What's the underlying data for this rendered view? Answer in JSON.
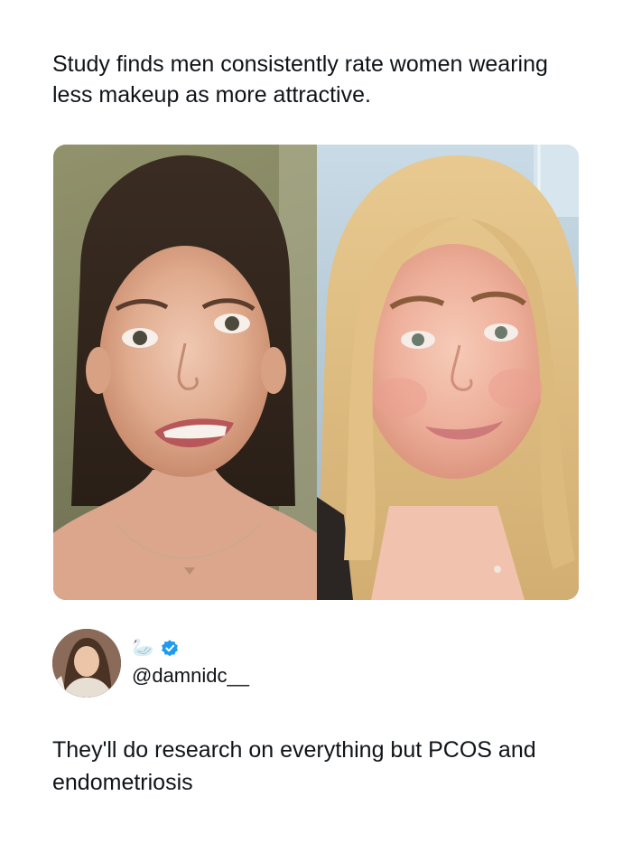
{
  "post": {
    "headline": "Study finds men consistently rate women wearing less makeup as more attractive.",
    "images": [
      {
        "icon": "portrait-photo-brunette-no-makeup"
      },
      {
        "icon": "portrait-photo-blonde-no-makeup"
      }
    ]
  },
  "author": {
    "display_name_emoji": "🦢",
    "verified_color": "#1d9bf0",
    "handle": "@damnidc__"
  },
  "reply": {
    "text": "They'll do research on everything but PCOS and endometriosis"
  }
}
